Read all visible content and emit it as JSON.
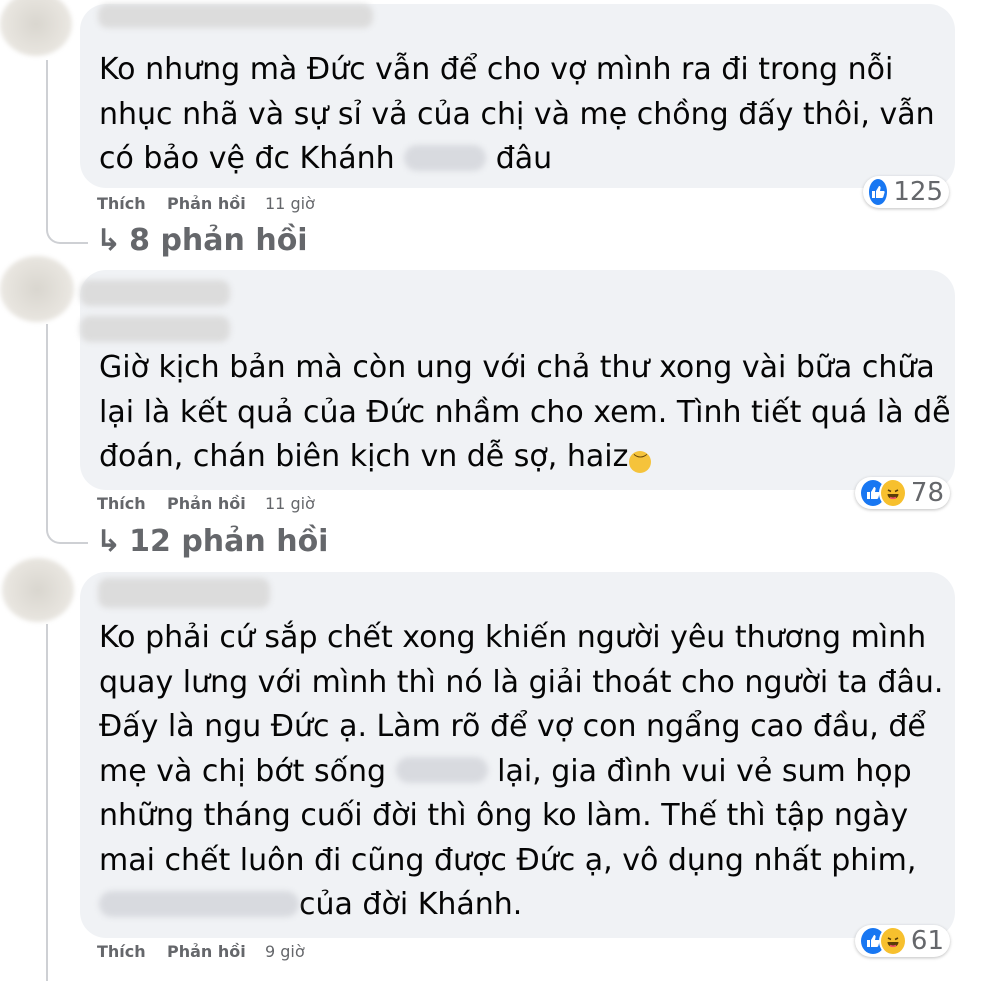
{
  "comments": [
    {
      "text_lines": [
        "Ko nhưng mà Đức vẫn để cho vợ mình ra đi trong nỗi",
        "nhục nhã và sự sỉ vả của chị và mẹ chồng đấy thôi, vẫn",
        "có bảo vệ đc Khánh",
        "đâu"
      ],
      "like_label": "Thích",
      "reply_label": "Phản hồi",
      "time": "11 giờ",
      "reaction_count": "125",
      "reaction_icons": [
        "like-icon"
      ],
      "replies_label": "8 phản hồi"
    },
    {
      "text_lines": [
        "Giờ kịch bản mà còn ung với chả thư xong vài bữa chữa",
        "lại là kết quả của Đức nhầm cho xem. Tình tiết quá là dễ",
        "đoán, chán biên kịch vn dễ sợ, haiz"
      ],
      "emoji": "sad-face-emoji",
      "like_label": "Thích",
      "reply_label": "Phản hồi",
      "time": "11 giờ",
      "reaction_count": "78",
      "reaction_icons": [
        "like-icon",
        "haha-icon"
      ],
      "replies_label": "12 phản hồi"
    },
    {
      "text_lines": [
        "Ko phải cứ sắp chết xong khiến người yêu thương mình",
        "quay lưng với mình thì nó là giải thoát cho người ta đâu.",
        "Đấy là ngu Đức ạ. Làm rõ để vợ con ngẩng cao đầu, để",
        "mẹ và chị bớt sống",
        "lại, gia đình vui vẻ sum họp",
        "những tháng cuối đời thì ông ko làm. Thế thì tập ngày",
        "mai chết luôn đi cũng được Đức ạ, vô dụng nhất phim,",
        "của đời Khánh."
      ],
      "like_label": "Thích",
      "reply_label": "Phản hồi",
      "time": "9 giờ",
      "reaction_count": "61",
      "reaction_icons": [
        "like-icon",
        "haha-icon"
      ]
    }
  ],
  "colors": {
    "bubble": "#f0f2f5",
    "meta_text": "#65676b",
    "like_blue": "#1877f2",
    "haha_yellow": "#f7c02e",
    "thread_line": "#ced0d4"
  }
}
